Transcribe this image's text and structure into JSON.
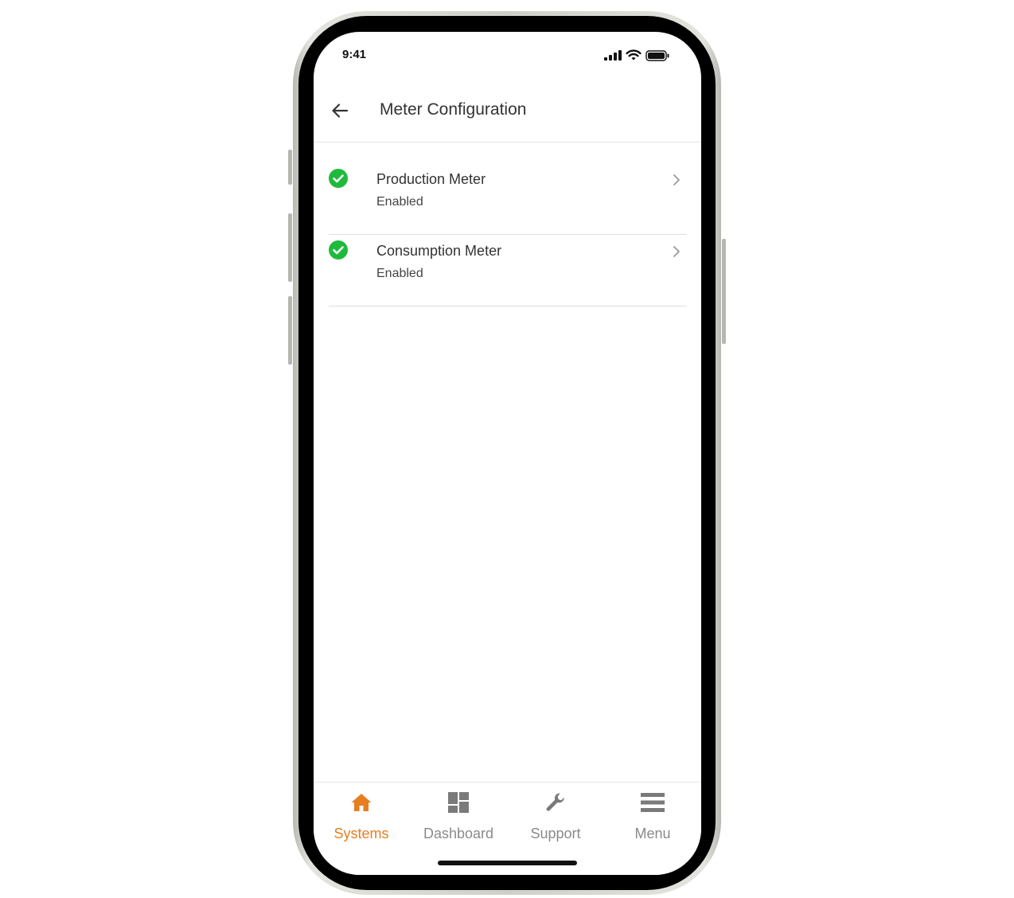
{
  "status_bar": {
    "time": "9:41"
  },
  "header": {
    "title": "Meter Configuration"
  },
  "meters": [
    {
      "title": "Production Meter",
      "status": "Enabled"
    },
    {
      "title": "Consumption Meter",
      "status": "Enabled"
    }
  ],
  "tabbar": {
    "tabs": [
      {
        "label": "Systems",
        "icon": "home-icon",
        "active": true
      },
      {
        "label": "Dashboard",
        "icon": "dashboard-icon",
        "active": false
      },
      {
        "label": "Support",
        "icon": "wrench-icon",
        "active": false
      },
      {
        "label": "Menu",
        "icon": "hamburger-icon",
        "active": false
      }
    ]
  },
  "colors": {
    "accent": "#e67e22",
    "check_green": "#1fba3c",
    "inactive_tab": "#8a8a8a"
  }
}
